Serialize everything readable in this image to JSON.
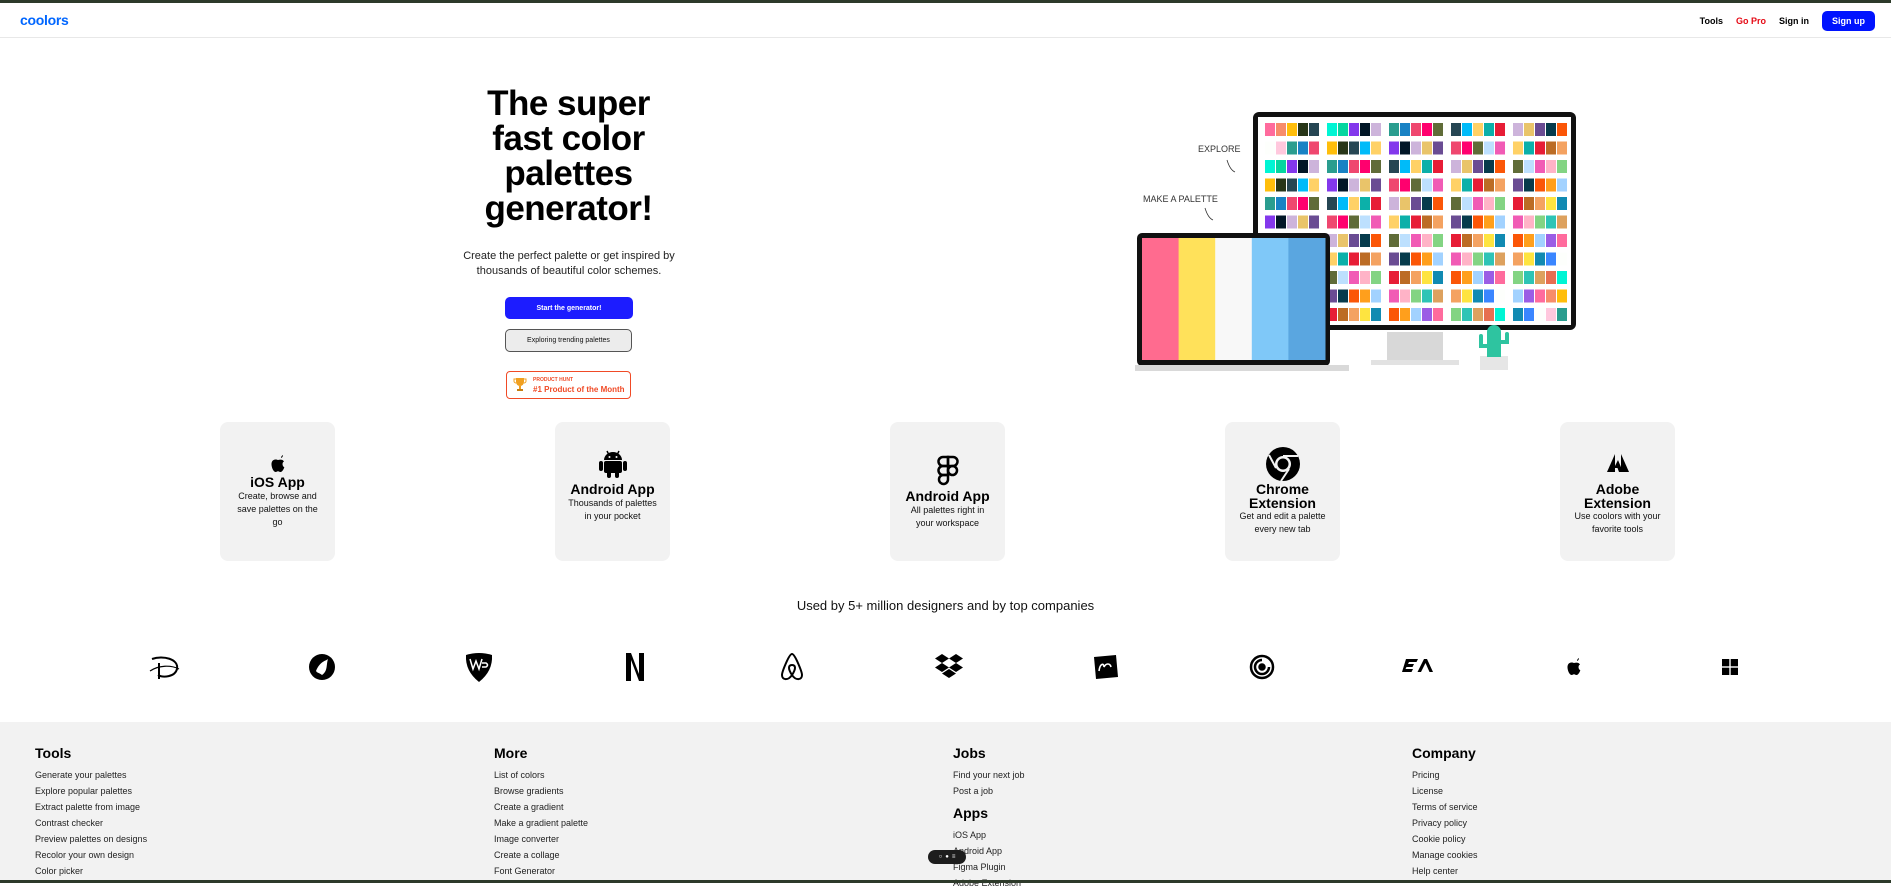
{
  "nav": {
    "logo": "coolors",
    "tools": "Tools",
    "go_pro": "Go Pro",
    "sign_in": "Sign in",
    "sign_up": "Sign up"
  },
  "hero": {
    "title_lines": [
      "The super",
      "fast color",
      "palettes",
      "generator!"
    ],
    "subtitle_line1": "Create the perfect palette or get inspired by",
    "subtitle_line2": "thousands of beautiful color schemes.",
    "start_button": "Start the generator!",
    "explore_button": "Exploring trending palettes",
    "badge_small": "PRODUCT HUNT",
    "badge_big": "#1 Product of the Month"
  },
  "illustration": {
    "explore_label": "EXPLORE",
    "make_label": "MAKE A PALETTE",
    "laptop_colors": [
      "#ff6b8f",
      "#ffe15a",
      "#f8f8f8",
      "#7fc8f8",
      "#5aa6e0"
    ]
  },
  "cards": [
    {
      "icon": "apple-icon",
      "title": "iOS App",
      "desc": "Create, browse and save palettes on the go"
    },
    {
      "icon": "android-icon",
      "title": "Android App",
      "desc": "Thousands of palettes in your pocket"
    },
    {
      "icon": "figma-icon",
      "title": "Android App",
      "desc": "All palettes right in your workspace"
    },
    {
      "icon": "chrome-icon",
      "title": "Chrome Extension",
      "desc": "Get and edit a palette every new tab"
    },
    {
      "icon": "adobe-icon",
      "title": "Adobe Extension",
      "desc": "Use coolors with your favorite tools"
    }
  ],
  "used_by": "Used by 5+ million designers and by top companies",
  "company_logos": [
    "disney-logo",
    "dreamworks-logo",
    "warner-bros-logo",
    "netflix-logo",
    "airbnb-logo",
    "dropbox-logo",
    "hasbro-logo",
    "ubisoft-logo",
    "ea-logo",
    "apple-logo",
    "microsoft-logo"
  ],
  "footer": {
    "tools": {
      "title": "Tools",
      "links": [
        "Generate your palettes",
        "Explore popular palettes",
        "Extract palette from image",
        "Contrast checker",
        "Preview palettes on designs",
        "Recolor your own design",
        "Color picker"
      ]
    },
    "more": {
      "title": "More",
      "links": [
        "List of colors",
        "Browse gradients",
        "Create a gradient",
        "Make a gradient palette",
        "Image converter",
        "Create a collage",
        "Font Generator"
      ]
    },
    "jobs": {
      "title": "Jobs",
      "links": [
        "Find your next job",
        "Post a job"
      ]
    },
    "apps": {
      "title": "Apps",
      "links": [
        "iOS App",
        "Android App",
        "Figma Plugin",
        "Adobe Extension"
      ]
    },
    "company": {
      "title": "Company",
      "links": [
        "Pricing",
        "License",
        "Terms of service",
        "Privacy policy",
        "Cookie policy",
        "Manage cookies",
        "Help center"
      ]
    }
  }
}
